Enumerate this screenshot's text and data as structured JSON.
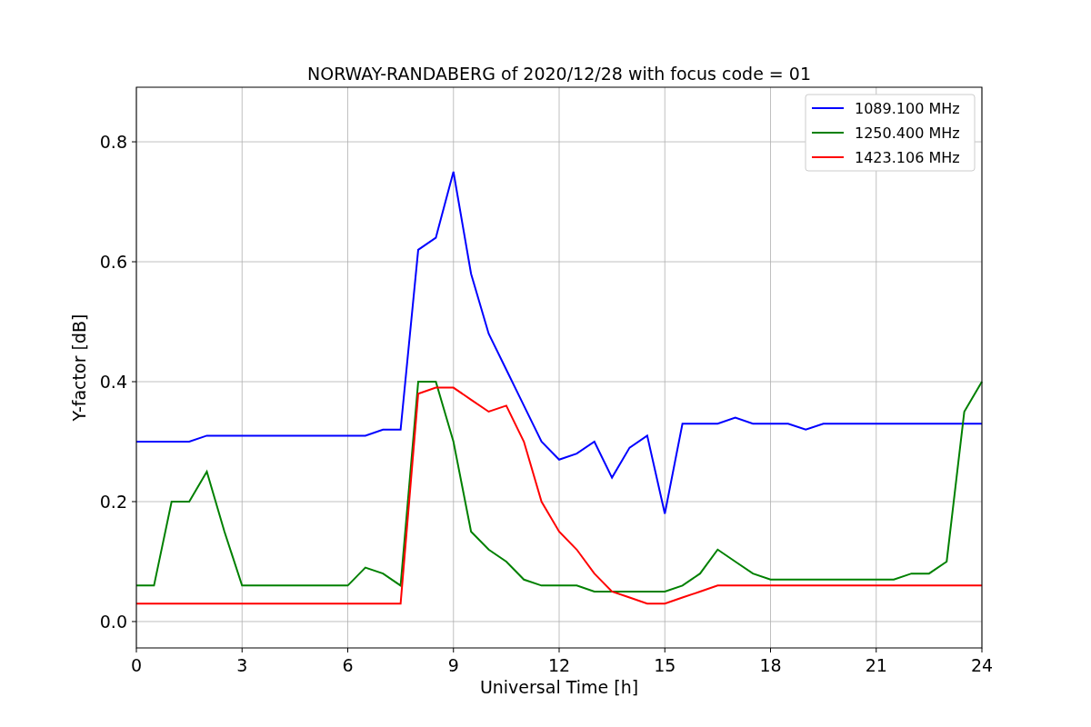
{
  "chart_data": {
    "type": "line",
    "title": "NORWAY-RANDABERG of 2020/12/28 with focus code = 01",
    "xlabel": "Universal Time [h]",
    "ylabel": "Y-factor [dB]",
    "x": [
      0,
      0.5,
      1,
      1.5,
      2,
      2.5,
      3,
      3.5,
      4,
      4.5,
      5,
      5.5,
      6,
      6.5,
      7,
      7.5,
      8,
      8.5,
      9,
      9.5,
      10,
      10.5,
      11,
      11.5,
      12,
      12.5,
      13,
      13.5,
      14,
      14.5,
      15,
      15.5,
      16,
      16.5,
      17,
      17.5,
      18,
      18.5,
      19,
      19.5,
      20,
      20.5,
      21,
      21.5,
      22,
      22.5,
      23,
      23.5,
      24
    ],
    "series": [
      {
        "name": "1089.100 MHz",
        "color": "#0000ff",
        "values": [
          0.3,
          0.3,
          0.3,
          0.3,
          0.31,
          0.31,
          0.31,
          0.31,
          0.31,
          0.31,
          0.31,
          0.31,
          0.31,
          0.31,
          0.32,
          0.32,
          0.62,
          0.64,
          0.75,
          0.58,
          0.48,
          0.42,
          0.36,
          0.3,
          0.27,
          0.28,
          0.3,
          0.24,
          0.29,
          0.31,
          0.18,
          0.33,
          0.33,
          0.33,
          0.34,
          0.33,
          0.33,
          0.33,
          0.32,
          0.33,
          0.33,
          0.33,
          0.33,
          0.33,
          0.33,
          0.33,
          0.33,
          0.33,
          0.33
        ]
      },
      {
        "name": "1250.400 MHz",
        "color": "#008000",
        "values": [
          0.06,
          0.06,
          0.2,
          0.2,
          0.25,
          0.15,
          0.06,
          0.06,
          0.06,
          0.06,
          0.06,
          0.06,
          0.06,
          0.09,
          0.08,
          0.06,
          0.4,
          0.4,
          0.3,
          0.15,
          0.12,
          0.1,
          0.07,
          0.06,
          0.06,
          0.06,
          0.05,
          0.05,
          0.05,
          0.05,
          0.05,
          0.06,
          0.08,
          0.12,
          0.1,
          0.08,
          0.07,
          0.07,
          0.07,
          0.07,
          0.07,
          0.07,
          0.07,
          0.07,
          0.08,
          0.08,
          0.1,
          0.35,
          0.4
        ]
      },
      {
        "name": "1423.106 MHz",
        "color": "#ff0000",
        "values": [
          0.03,
          0.03,
          0.03,
          0.03,
          0.03,
          0.03,
          0.03,
          0.03,
          0.03,
          0.03,
          0.03,
          0.03,
          0.03,
          0.03,
          0.03,
          0.03,
          0.38,
          0.39,
          0.39,
          0.37,
          0.35,
          0.36,
          0.3,
          0.2,
          0.15,
          0.12,
          0.08,
          0.05,
          0.04,
          0.03,
          0.03,
          0.04,
          0.05,
          0.06,
          0.06,
          0.06,
          0.06,
          0.06,
          0.06,
          0.06,
          0.06,
          0.06,
          0.06,
          0.06,
          0.06,
          0.06,
          0.06,
          0.06,
          0.06
        ]
      }
    ],
    "xlim": [
      0,
      24
    ],
    "ylim": [
      -0.044,
      0.891
    ],
    "grid": true,
    "legend": true,
    "xticks": [
      0,
      3,
      6,
      9,
      12,
      15,
      18,
      21,
      24
    ],
    "yticks": [
      {
        "value": 0,
        "label": "0.0"
      },
      {
        "value": 0.2,
        "label": "0.2"
      },
      {
        "value": 0.4,
        "label": "0.4"
      },
      {
        "value": 0.6,
        "label": "0.6"
      },
      {
        "value": 0.8,
        "label": "0.8"
      }
    ]
  }
}
